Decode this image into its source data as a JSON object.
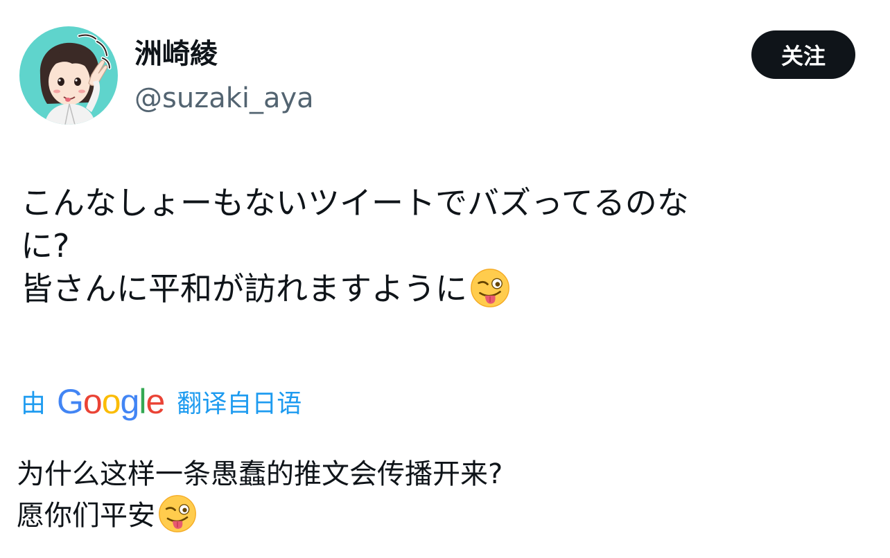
{
  "user": {
    "display_name": "洲崎綾",
    "handle": "@suzaki_aya",
    "avatar_icon": "user-avatar-illustration"
  },
  "follow_button": {
    "label": "关注"
  },
  "tweet": {
    "lines": [
      "こんなしょーもないツイートでバズってるのな",
      "に?",
      "皆さんに平和が訪れますように"
    ],
    "emoji": "winking-face-with-tongue-icon"
  },
  "translation_bar": {
    "by": "由",
    "logo_letters": [
      {
        "char": "G",
        "color": "#4285F4"
      },
      {
        "char": "o",
        "color": "#EA4335"
      },
      {
        "char": "o",
        "color": "#FBBC05"
      },
      {
        "char": "g",
        "color": "#4285F4"
      },
      {
        "char": "l",
        "color": "#34A853"
      },
      {
        "char": "e",
        "color": "#EA4335"
      }
    ],
    "from_language": "翻译自日语"
  },
  "translation": {
    "lines": [
      "为什么这样一条愚蠢的推文会传播开来?",
      "愿你们平安"
    ],
    "emoji": "winking-face-with-tongue-icon"
  },
  "colors": {
    "link_blue": "#1d9bf0",
    "button_bg": "#0f1419",
    "handle_gray": "#536471",
    "avatar_bg": "#5fd4cc"
  }
}
